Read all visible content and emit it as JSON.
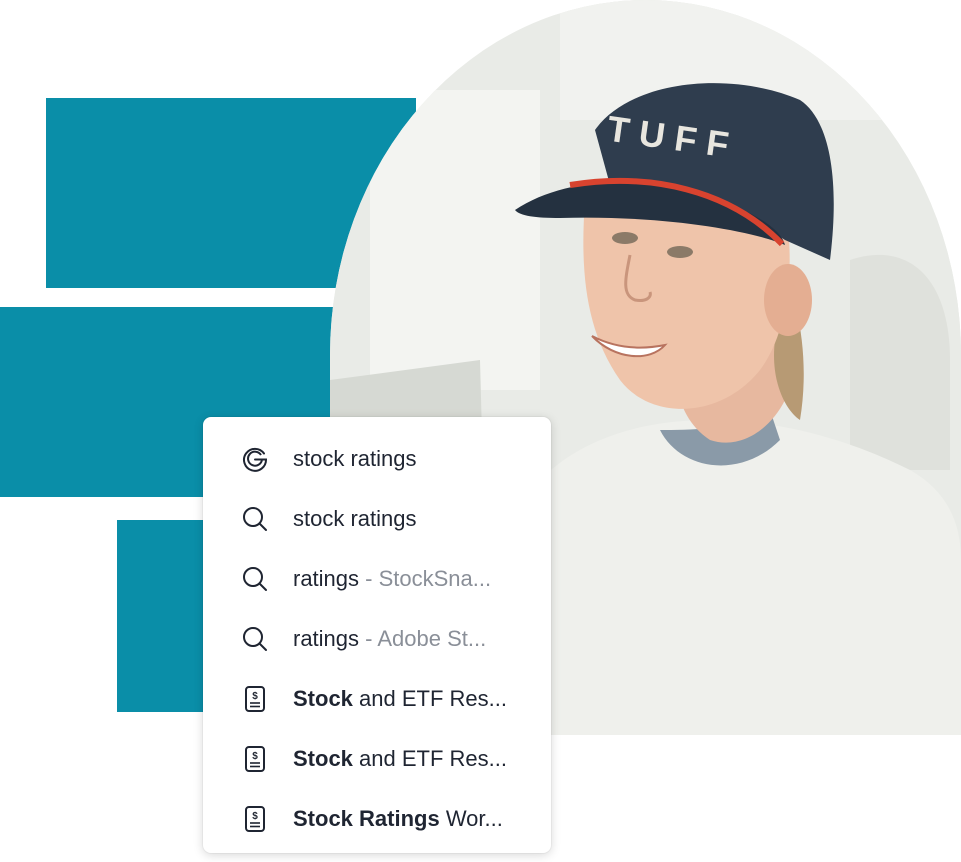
{
  "suggestions": [
    {
      "icon": "google-icon",
      "bold": "",
      "text": "stock ratings",
      "source": ""
    },
    {
      "icon": "search-icon",
      "bold": "",
      "text": "stock ratings",
      "source": ""
    },
    {
      "icon": "search-icon",
      "bold": "",
      "text": "ratings",
      "source": " - StockSna..."
    },
    {
      "icon": "search-icon",
      "bold": "",
      "text": "ratings",
      "source": " - Adobe St..."
    },
    {
      "icon": "document-dollar-icon",
      "bold": "Stock",
      "text": " and ETF Res...",
      "source": ""
    },
    {
      "icon": "document-dollar-icon",
      "bold": "Stock",
      "text": " and ETF Res...",
      "source": ""
    },
    {
      "icon": "document-dollar-icon",
      "bold": "Stock Ratings",
      "text": " Wor...",
      "source": ""
    }
  ],
  "cap_text": "TUFF",
  "colors": {
    "accent": "#0a8ea8",
    "text": "#1f2532",
    "muted": "#8a8f98"
  }
}
